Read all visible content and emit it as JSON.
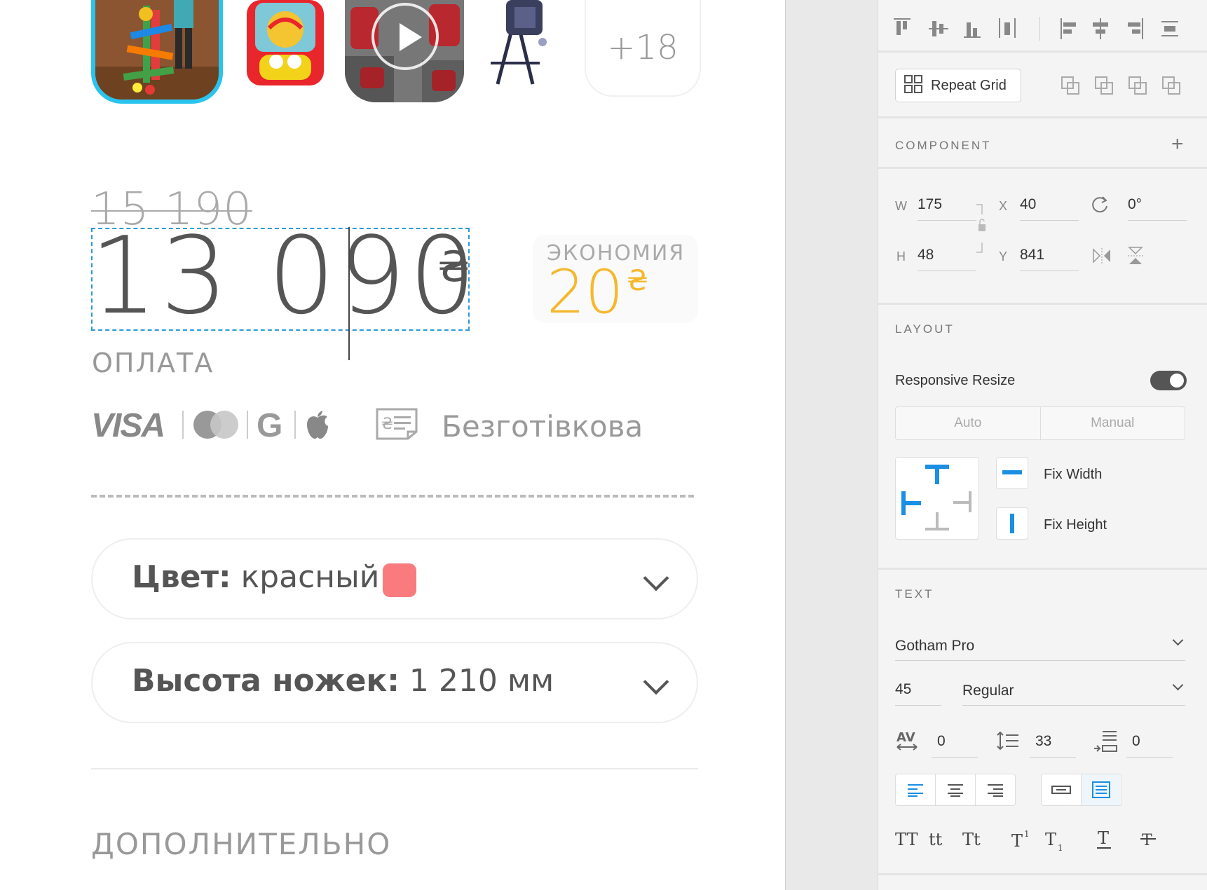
{
  "artboard": {
    "more_count": "+18",
    "old_price": "15 190",
    "price": "13 090",
    "currency": "₴",
    "savings_label": "ЭКОНОМИЯ",
    "savings_value": "20",
    "payment_label": "ОПЛАТА",
    "visa": "VISA",
    "cashless": "Безготівкова",
    "color_select": {
      "label": "Цвет:",
      "value": "красный",
      "swatch": "#f97b7e"
    },
    "height_select": {
      "label": "Высота ножек:",
      "value": "1 210 мм"
    },
    "extra_label": "ДОПОЛНИТЕЛЬНО"
  },
  "panel": {
    "repeat_grid": "Repeat Grid",
    "component_title": "COMPONENT",
    "w_label": "W",
    "w_value": "175",
    "x_label": "X",
    "x_value": "40",
    "rotation": "0°",
    "h_label": "H",
    "h_value": "48",
    "y_label": "Y",
    "y_value": "841",
    "layout_title": "LAYOUT",
    "responsive_resize": "Responsive Resize",
    "seg_auto": "Auto",
    "seg_manual": "Manual",
    "fix_width": "Fix Width",
    "fix_height": "Fix Height",
    "text_title": "TEXT",
    "font_family": "Gotham Pro",
    "font_size": "45",
    "font_weight": "Regular",
    "char_spacing": "0",
    "line_spacing": "33",
    "para_spacing": "0",
    "case_upper": "TT",
    "case_lower": "tt",
    "case_title": "Tt"
  },
  "colors": {
    "accent": "#2c9bd6",
    "savings": "#f5b82e",
    "swatch": "#f97b7e"
  }
}
